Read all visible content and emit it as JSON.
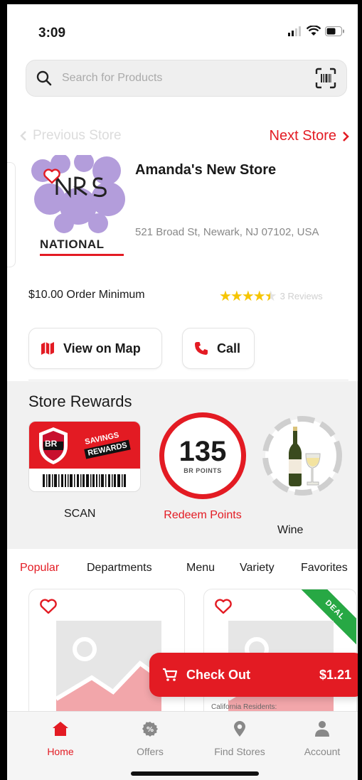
{
  "status_bar": {
    "time": "3:09"
  },
  "search": {
    "placeholder": "Search for Products"
  },
  "store_nav": {
    "previous_label": "Previous Store",
    "next_label": "Next Store"
  },
  "store": {
    "name": "Amanda's New Store",
    "address": "521 Broad St, Newark, NJ 07102, USA",
    "order_minimum": "$10.00 Order Minimum",
    "rating": 4.5,
    "reviews": "3 Reviews",
    "logo_text": "NATIONAL"
  },
  "actions": {
    "map_label": "View on Map",
    "call_label": "Call"
  },
  "rewards": {
    "title": "Store Rewards",
    "scan_label": "SCAN",
    "card_text_1": "SAVINGS",
    "card_text_2": "REWARDS",
    "card_badge": "BR",
    "points": "135",
    "points_unit": "BR POINTS",
    "redeem_label": "Redeem Points",
    "wine_label": "Wine"
  },
  "tabs": [
    {
      "label": "Popular",
      "active": true
    },
    {
      "label": "Departments",
      "active": false
    },
    {
      "label": "Menu",
      "active": false
    },
    {
      "label": "Variety",
      "active": false
    },
    {
      "label": "Favorites",
      "active": false
    }
  ],
  "products": {
    "deal_label": "DEAL",
    "ca_note": "California Residents:"
  },
  "checkout": {
    "label": "Check Out",
    "amount": "$1.21"
  },
  "bottom_nav": [
    {
      "label": "Home",
      "icon": "home-icon",
      "active": true
    },
    {
      "label": "Offers",
      "icon": "offers-icon",
      "active": false
    },
    {
      "label": "Find Stores",
      "icon": "location-pin-icon",
      "active": false
    },
    {
      "label": "Account",
      "icon": "person-icon",
      "active": false
    }
  ],
  "colors": {
    "accent": "#e31b23",
    "star": "#f6c500",
    "deal": "#27a844"
  }
}
